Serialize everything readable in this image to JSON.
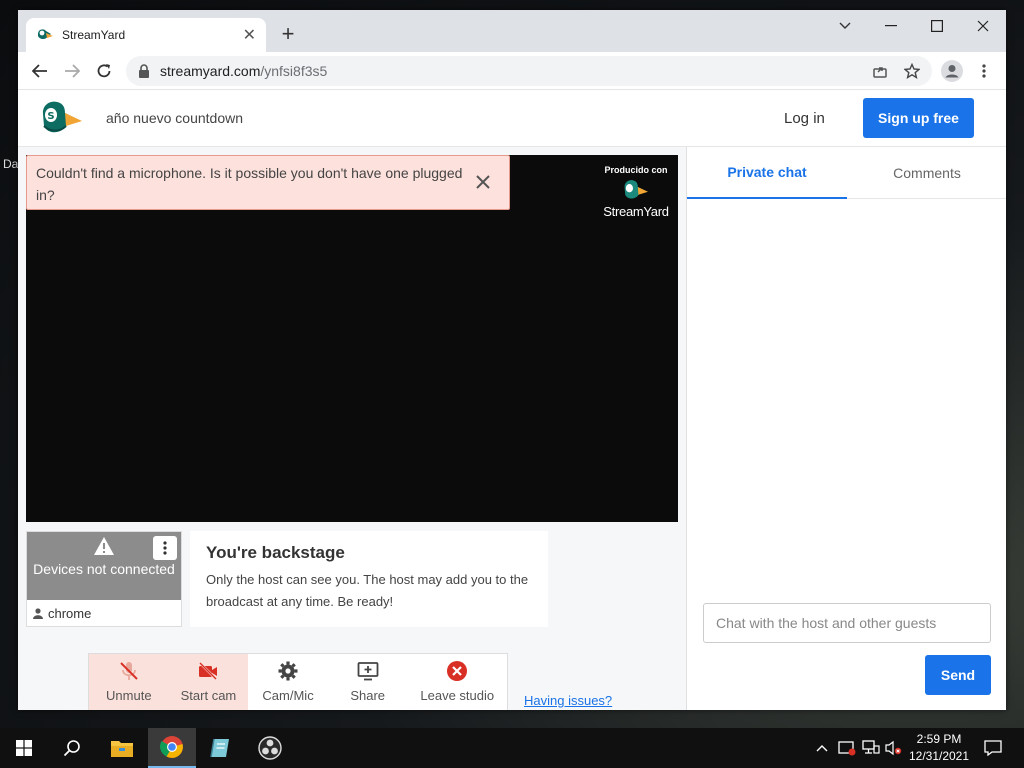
{
  "browser": {
    "tab_title": "StreamYard",
    "url_host": "streamyard.com",
    "url_path": "/ynfsi8f3s5"
  },
  "desktop": {
    "label": "Da"
  },
  "header": {
    "broadcast_title": "año nuevo countdown",
    "login_label": "Log in",
    "signup_label": "Sign up free"
  },
  "alert": {
    "message": "Couldn't find a microphone. Is it possible you don't have one plugged in?"
  },
  "watermark": {
    "produced_label": "Producido con",
    "brand": "StreamYard"
  },
  "participant": {
    "status": "Devices not connected",
    "name": "chrome"
  },
  "backstage": {
    "title": "You're backstage",
    "message": "Only the host can see you. The host may add you to the broadcast at any time. Be ready!"
  },
  "controls": {
    "unmute": "Unmute",
    "start_cam": "Start cam",
    "cam_mic": "Cam/Mic",
    "share": "Share",
    "leave": "Leave studio",
    "issues_link": "Having issues?"
  },
  "chat": {
    "tabs": [
      {
        "label": "Private chat",
        "active": true
      },
      {
        "label": "Comments",
        "active": false
      }
    ],
    "input_placeholder": "Chat with the host and other guests",
    "send_label": "Send"
  },
  "taskbar": {
    "time": "2:59 PM",
    "date": "12/31/2021"
  },
  "colors": {
    "accent": "#1a73e8",
    "alert_bg": "#fde1dc",
    "alert_icon": "#d93025",
    "video_bg": "#0b0b0b"
  }
}
